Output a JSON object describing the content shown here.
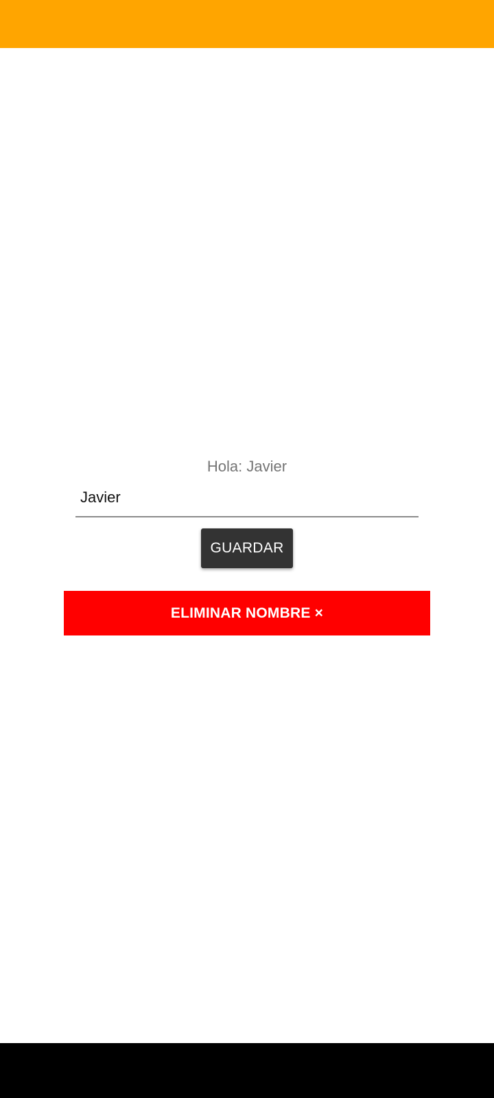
{
  "colors": {
    "status_bar": "#FFA500",
    "background": "#FFFFFF",
    "save_button_bg": "#333333",
    "delete_button_bg": "#FF0000",
    "greeting_text": "#757575",
    "navigation_bar": "#000000"
  },
  "greeting": {
    "text": "Hola: Javier"
  },
  "name_input": {
    "value": "Javier"
  },
  "save_button": {
    "label": "GUARDAR"
  },
  "delete_button": {
    "label": "ELIMINAR NOMBRE ×"
  }
}
